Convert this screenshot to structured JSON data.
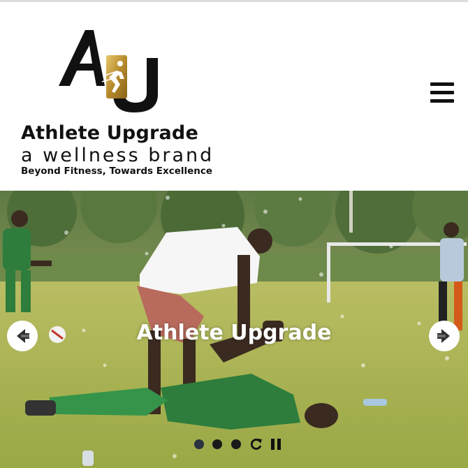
{
  "header": {
    "brand_name": "Athlete Upgrade",
    "brand_subtitle": "a wellness brand",
    "tagline": "Beyond Fitness, Towards Excellence",
    "menu_icon": "hamburger-menu-icon"
  },
  "slider": {
    "caption": "Athlete Upgrade",
    "prev_icon": "arrow-left-icon",
    "next_icon": "arrow-right-icon",
    "dots_total": 3,
    "active_dot": 1,
    "controls": [
      "replay-icon",
      "pause-icon"
    ]
  },
  "colors": {
    "text": "#111111",
    "logo_gold": "#c9a24a",
    "grass": "#a7b34c",
    "jersey_green": "#2e7d3c"
  }
}
